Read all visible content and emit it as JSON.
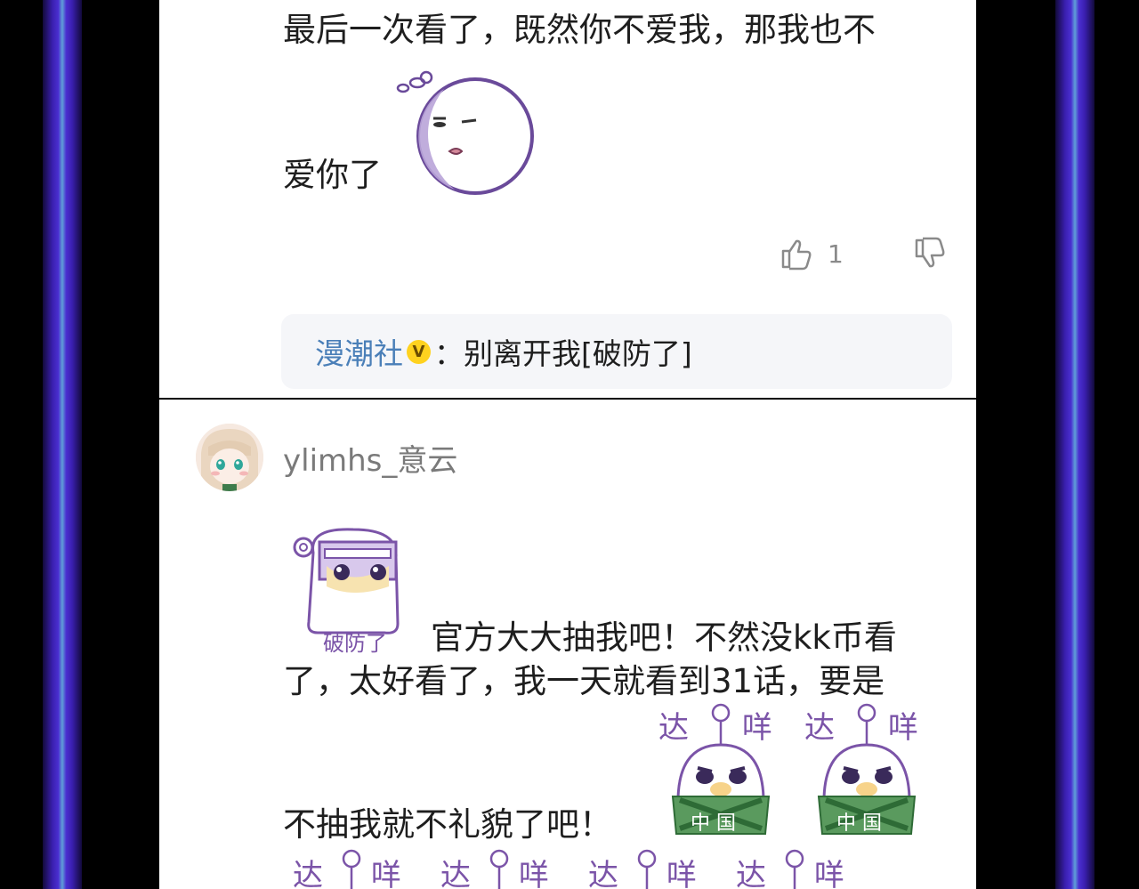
{
  "comment_top": {
    "line1": "最后一次看了，既然你不爱我，那我也不",
    "line2": "爱你了",
    "sticker1": "moon-face-sticker",
    "likes_count": "1",
    "icons": {
      "like": "thumb-up-icon",
      "dislike": "thumb-down-icon",
      "verified": "verified-v-icon"
    },
    "reply": {
      "author": "漫潮社",
      "badge": "V",
      "separator": "：",
      "text": "别离开我[破防了]"
    }
  },
  "comment_bottom": {
    "username": "ylimhs_意云",
    "avatar": "user-avatar",
    "sticker_broken_label": "破防了",
    "line1": "官方大大抽我吧！不然没kk币看",
    "line2": "了，太好看了，我一天就看到31话，要是",
    "line3": "不抽我就不礼貌了吧！",
    "sticker_text_left": "达",
    "sticker_text_right": "咩",
    "sticker_badge": "中 国"
  },
  "colors": {
    "border_glow": "#4a2fd0",
    "sticker_purple": "#7b54a8",
    "reply_author": "#4a7fb8",
    "badge_yellow": "#ffd21f"
  }
}
